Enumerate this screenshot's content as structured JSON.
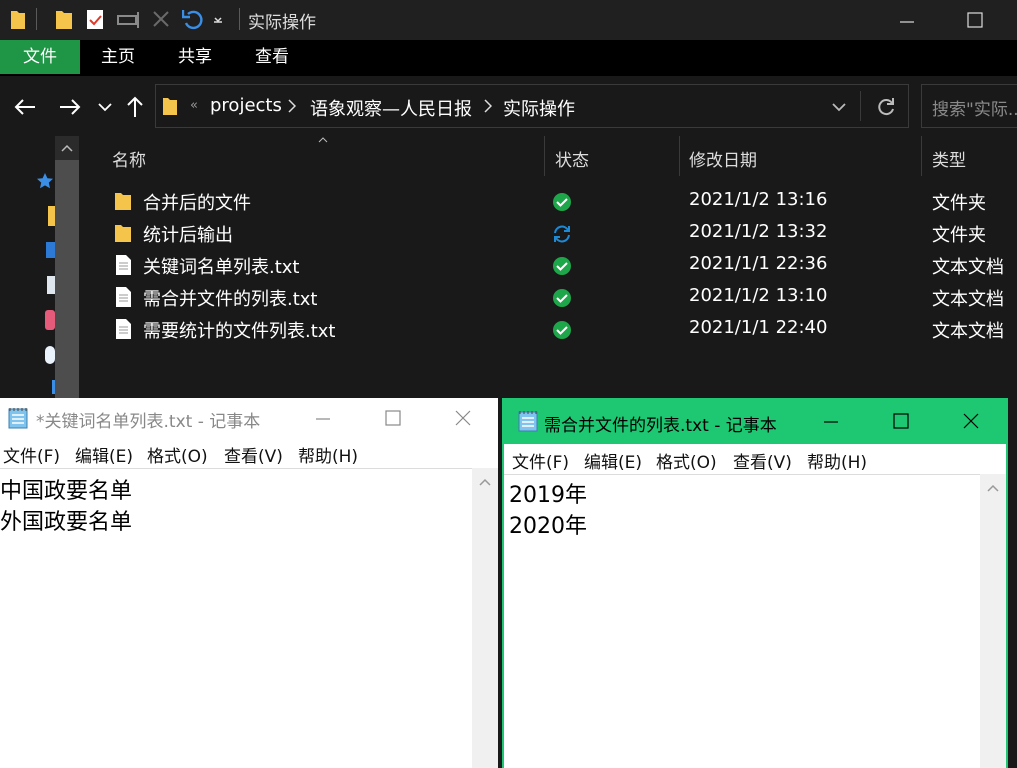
{
  "explorer": {
    "title": "实际操作",
    "ribbon_tabs": [
      "文件",
      "主页",
      "共享",
      "查看"
    ],
    "breadcrumb": [
      "projects",
      "语象观察—人民日报",
      "实际操作"
    ],
    "search_placeholder": "搜索\"实际...",
    "columns": [
      "名称",
      "状态",
      "修改日期",
      "类型"
    ],
    "files": [
      {
        "name": "合并后的文件",
        "icon": "folder-icon",
        "status": "synced",
        "date": "2021/1/2 13:16",
        "type": "文件夹"
      },
      {
        "name": "统计后输出",
        "icon": "folder-icon",
        "status": "syncing",
        "date": "2021/1/2 13:32",
        "type": "文件夹"
      },
      {
        "name": "关键词名单列表.txt",
        "icon": "text-file-icon",
        "status": "synced",
        "date": "2021/1/1 22:36",
        "type": "文本文档"
      },
      {
        "name": "需合并文件的列表.txt",
        "icon": "text-file-icon",
        "status": "synced",
        "date": "2021/1/2 13:10",
        "type": "文本文档"
      },
      {
        "name": "需要统计的文件列表.txt",
        "icon": "text-file-icon",
        "status": "synced",
        "date": "2021/1/1 22:40",
        "type": "文本文档"
      }
    ],
    "colors": {
      "background": "#191919",
      "ribbon_file_tab": "#1e9645",
      "status_ok": "#1ea64a",
      "status_sync": "#1e8ad6"
    }
  },
  "notepad_left": {
    "title": "*关键词名单列表.txt - 记事本",
    "menu": [
      "文件(F)",
      "编辑(E)",
      "格式(O)",
      "查看(V)",
      "帮助(H)"
    ],
    "lines": [
      "中国政要名单",
      "外国政要名单"
    ]
  },
  "notepad_right": {
    "title": "需合并文件的列表.txt - 记事本",
    "menu": [
      "文件(F)",
      "编辑(E)",
      "格式(O)",
      "查看(V)",
      "帮助(H)"
    ],
    "lines": [
      "2019年",
      "2020年"
    ],
    "accent": "#1ec772"
  }
}
